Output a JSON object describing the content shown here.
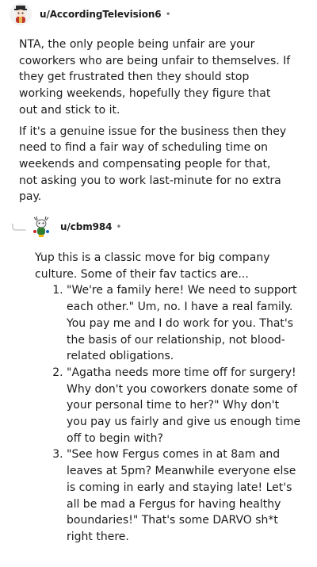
{
  "comments": [
    {
      "username": "u/AccordingTelevision6",
      "separator": "•",
      "paragraphs": [
        "NTA, the only people being unfair are your coworkers who are being unfair to themselves. If they get frustrated then they should stop working weekends, hopefully they figure that out and stick to it.",
        "If it's a genuine issue for the business then they need to find a fair way of scheduling time on weekends and compensating people for that, not asking you to work last-minute for no extra pay."
      ]
    },
    {
      "username": "u/cbm984",
      "separator": "•",
      "intro": "Yup this is a classic move for big company culture. Some of their fav tactics are...",
      "list": [
        "\"We're a family here! We need to support each other.\" Um, no. I have a real family. You pay me and I do work for you. That's the basis of our relationship, not blood-related obligations.",
        "\"Agatha needs more time off for surgery! Why don't you coworkers donate some of your personal time to her?\" Why don't you pay us fairly and give us enough time off to begin with?",
        "\"See how Fergus comes in at 8am and leaves at 5pm? Meanwhile everyone else is coming in early and staying late! Let's all be mad a Fergus for having healthy boundaries!\" That's some DARVO sh*t right there."
      ]
    }
  ],
  "icons": {
    "avatar_1": "snoo-avatar-icon",
    "avatar_2": "snoo-avatar-icon",
    "reply_thread": "reply-arrow-icon"
  },
  "colors": {
    "text": "#1c1c1c",
    "meta": "#7c7c7c",
    "thread_line": "#c8cbcd"
  }
}
